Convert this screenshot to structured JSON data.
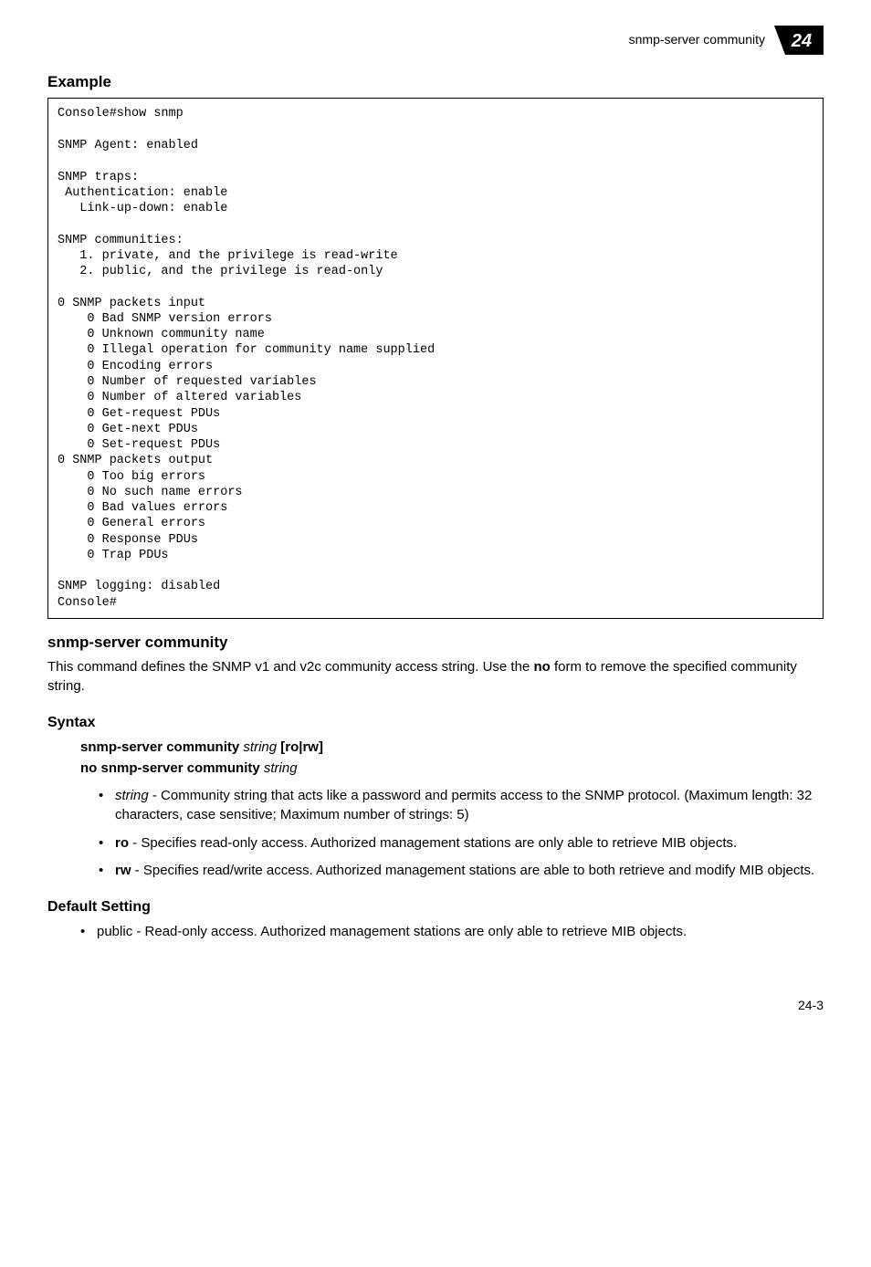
{
  "header": {
    "running_title": "snmp-server community",
    "chapter_number": "24"
  },
  "sections": {
    "example_heading": "Example",
    "console_output": "Console#show snmp\n\nSNMP Agent: enabled\n\nSNMP traps:\n Authentication: enable\n   Link-up-down: enable\n\nSNMP communities:\n   1. private, and the privilege is read-write\n   2. public, and the privilege is read-only\n\n0 SNMP packets input\n    0 Bad SNMP version errors\n    0 Unknown community name\n    0 Illegal operation for community name supplied\n    0 Encoding errors\n    0 Number of requested variables\n    0 Number of altered variables\n    0 Get-request PDUs\n    0 Get-next PDUs\n    0 Set-request PDUs\n0 SNMP packets output\n    0 Too big errors\n    0 No such name errors\n    0 Bad values errors\n    0 General errors\n    0 Response PDUs\n    0 Trap PDUs\n\nSNMP logging: disabled\nConsole#",
    "cmd_heading": "snmp-server community",
    "cmd_desc_pre": "This command defines the SNMP v1 and v2c community access string. Use the ",
    "cmd_desc_bold": "no",
    "cmd_desc_post": " form to remove the specified community string.",
    "syntax_heading": "Syntax",
    "syntax": {
      "line1_cmd": "snmp-server community",
      "line1_arg": "string",
      "line1_opts_open": " [",
      "line1_opt1": "ro",
      "line1_sep": "|",
      "line1_opt2": "rw",
      "line1_opts_close": "]",
      "line2_cmd": "no snmp-server community",
      "line2_arg": "string"
    },
    "param_bullets": {
      "b1_term": "string",
      "b1_rest": " - Community string that acts like a password and permits access to the SNMP protocol. (Maximum length: 32 characters, case sensitive; Maximum number of strings: 5)",
      "b2_term": "ro",
      "b2_rest": " - Specifies read-only access. Authorized management stations are only able to retrieve MIB objects.",
      "b3_term": "rw",
      "b3_rest": " - Specifies read/write access. Authorized management stations are able to both retrieve and modify MIB objects."
    },
    "default_heading": "Default Setting",
    "default_bullet": "public - Read-only access. Authorized management stations are only able to retrieve MIB objects."
  },
  "footer": {
    "page_number": "24-3"
  }
}
